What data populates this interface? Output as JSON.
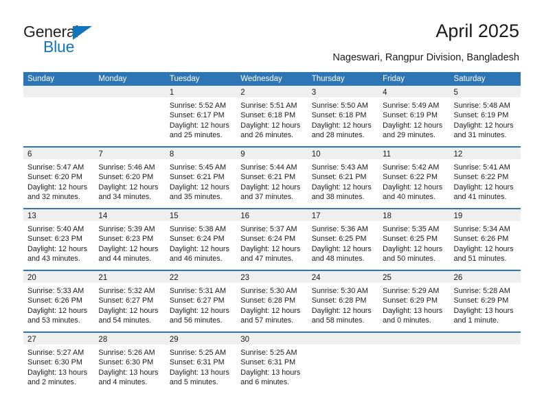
{
  "brand": {
    "name_part1": "General",
    "name_part2": "Blue",
    "color_dark": "#231f20",
    "color_blue": "#1275bc"
  },
  "header": {
    "title": "April 2025",
    "subtitle": "Nageswari, Rangpur Division, Bangladesh"
  },
  "theme": {
    "header_blue": "#2e75b6",
    "daynum_band": "#efefef",
    "text": "#1a1a1a"
  },
  "weekdays": [
    "Sunday",
    "Monday",
    "Tuesday",
    "Wednesday",
    "Thursday",
    "Friday",
    "Saturday"
  ],
  "weeks": [
    [
      {
        "day": "",
        "sunrise": "",
        "sunset": "",
        "daylight1": "",
        "daylight2": ""
      },
      {
        "day": "",
        "sunrise": "",
        "sunset": "",
        "daylight1": "",
        "daylight2": ""
      },
      {
        "day": "1",
        "sunrise": "Sunrise: 5:52 AM",
        "sunset": "Sunset: 6:17 PM",
        "daylight1": "Daylight: 12 hours",
        "daylight2": "and 25 minutes."
      },
      {
        "day": "2",
        "sunrise": "Sunrise: 5:51 AM",
        "sunset": "Sunset: 6:18 PM",
        "daylight1": "Daylight: 12 hours",
        "daylight2": "and 26 minutes."
      },
      {
        "day": "3",
        "sunrise": "Sunrise: 5:50 AM",
        "sunset": "Sunset: 6:18 PM",
        "daylight1": "Daylight: 12 hours",
        "daylight2": "and 28 minutes."
      },
      {
        "day": "4",
        "sunrise": "Sunrise: 5:49 AM",
        "sunset": "Sunset: 6:19 PM",
        "daylight1": "Daylight: 12 hours",
        "daylight2": "and 29 minutes."
      },
      {
        "day": "5",
        "sunrise": "Sunrise: 5:48 AM",
        "sunset": "Sunset: 6:19 PM",
        "daylight1": "Daylight: 12 hours",
        "daylight2": "and 31 minutes."
      }
    ],
    [
      {
        "day": "6",
        "sunrise": "Sunrise: 5:47 AM",
        "sunset": "Sunset: 6:20 PM",
        "daylight1": "Daylight: 12 hours",
        "daylight2": "and 32 minutes."
      },
      {
        "day": "7",
        "sunrise": "Sunrise: 5:46 AM",
        "sunset": "Sunset: 6:20 PM",
        "daylight1": "Daylight: 12 hours",
        "daylight2": "and 34 minutes."
      },
      {
        "day": "8",
        "sunrise": "Sunrise: 5:45 AM",
        "sunset": "Sunset: 6:21 PM",
        "daylight1": "Daylight: 12 hours",
        "daylight2": "and 35 minutes."
      },
      {
        "day": "9",
        "sunrise": "Sunrise: 5:44 AM",
        "sunset": "Sunset: 6:21 PM",
        "daylight1": "Daylight: 12 hours",
        "daylight2": "and 37 minutes."
      },
      {
        "day": "10",
        "sunrise": "Sunrise: 5:43 AM",
        "sunset": "Sunset: 6:21 PM",
        "daylight1": "Daylight: 12 hours",
        "daylight2": "and 38 minutes."
      },
      {
        "day": "11",
        "sunrise": "Sunrise: 5:42 AM",
        "sunset": "Sunset: 6:22 PM",
        "daylight1": "Daylight: 12 hours",
        "daylight2": "and 40 minutes."
      },
      {
        "day": "12",
        "sunrise": "Sunrise: 5:41 AM",
        "sunset": "Sunset: 6:22 PM",
        "daylight1": "Daylight: 12 hours",
        "daylight2": "and 41 minutes."
      }
    ],
    [
      {
        "day": "13",
        "sunrise": "Sunrise: 5:40 AM",
        "sunset": "Sunset: 6:23 PM",
        "daylight1": "Daylight: 12 hours",
        "daylight2": "and 43 minutes."
      },
      {
        "day": "14",
        "sunrise": "Sunrise: 5:39 AM",
        "sunset": "Sunset: 6:23 PM",
        "daylight1": "Daylight: 12 hours",
        "daylight2": "and 44 minutes."
      },
      {
        "day": "15",
        "sunrise": "Sunrise: 5:38 AM",
        "sunset": "Sunset: 6:24 PM",
        "daylight1": "Daylight: 12 hours",
        "daylight2": "and 46 minutes."
      },
      {
        "day": "16",
        "sunrise": "Sunrise: 5:37 AM",
        "sunset": "Sunset: 6:24 PM",
        "daylight1": "Daylight: 12 hours",
        "daylight2": "and 47 minutes."
      },
      {
        "day": "17",
        "sunrise": "Sunrise: 5:36 AM",
        "sunset": "Sunset: 6:25 PM",
        "daylight1": "Daylight: 12 hours",
        "daylight2": "and 48 minutes."
      },
      {
        "day": "18",
        "sunrise": "Sunrise: 5:35 AM",
        "sunset": "Sunset: 6:25 PM",
        "daylight1": "Daylight: 12 hours",
        "daylight2": "and 50 minutes."
      },
      {
        "day": "19",
        "sunrise": "Sunrise: 5:34 AM",
        "sunset": "Sunset: 6:26 PM",
        "daylight1": "Daylight: 12 hours",
        "daylight2": "and 51 minutes."
      }
    ],
    [
      {
        "day": "20",
        "sunrise": "Sunrise: 5:33 AM",
        "sunset": "Sunset: 6:26 PM",
        "daylight1": "Daylight: 12 hours",
        "daylight2": "and 53 minutes."
      },
      {
        "day": "21",
        "sunrise": "Sunrise: 5:32 AM",
        "sunset": "Sunset: 6:27 PM",
        "daylight1": "Daylight: 12 hours",
        "daylight2": "and 54 minutes."
      },
      {
        "day": "22",
        "sunrise": "Sunrise: 5:31 AM",
        "sunset": "Sunset: 6:27 PM",
        "daylight1": "Daylight: 12 hours",
        "daylight2": "and 56 minutes."
      },
      {
        "day": "23",
        "sunrise": "Sunrise: 5:30 AM",
        "sunset": "Sunset: 6:28 PM",
        "daylight1": "Daylight: 12 hours",
        "daylight2": "and 57 minutes."
      },
      {
        "day": "24",
        "sunrise": "Sunrise: 5:30 AM",
        "sunset": "Sunset: 6:28 PM",
        "daylight1": "Daylight: 12 hours",
        "daylight2": "and 58 minutes."
      },
      {
        "day": "25",
        "sunrise": "Sunrise: 5:29 AM",
        "sunset": "Sunset: 6:29 PM",
        "daylight1": "Daylight: 13 hours",
        "daylight2": "and 0 minutes."
      },
      {
        "day": "26",
        "sunrise": "Sunrise: 5:28 AM",
        "sunset": "Sunset: 6:29 PM",
        "daylight1": "Daylight: 13 hours",
        "daylight2": "and 1 minute."
      }
    ],
    [
      {
        "day": "27",
        "sunrise": "Sunrise: 5:27 AM",
        "sunset": "Sunset: 6:30 PM",
        "daylight1": "Daylight: 13 hours",
        "daylight2": "and 2 minutes."
      },
      {
        "day": "28",
        "sunrise": "Sunrise: 5:26 AM",
        "sunset": "Sunset: 6:30 PM",
        "daylight1": "Daylight: 13 hours",
        "daylight2": "and 4 minutes."
      },
      {
        "day": "29",
        "sunrise": "Sunrise: 5:25 AM",
        "sunset": "Sunset: 6:31 PM",
        "daylight1": "Daylight: 13 hours",
        "daylight2": "and 5 minutes."
      },
      {
        "day": "30",
        "sunrise": "Sunrise: 5:25 AM",
        "sunset": "Sunset: 6:31 PM",
        "daylight1": "Daylight: 13 hours",
        "daylight2": "and 6 minutes."
      },
      {
        "day": "",
        "sunrise": "",
        "sunset": "",
        "daylight1": "",
        "daylight2": ""
      },
      {
        "day": "",
        "sunrise": "",
        "sunset": "",
        "daylight1": "",
        "daylight2": ""
      },
      {
        "day": "",
        "sunrise": "",
        "sunset": "",
        "daylight1": "",
        "daylight2": ""
      }
    ]
  ]
}
